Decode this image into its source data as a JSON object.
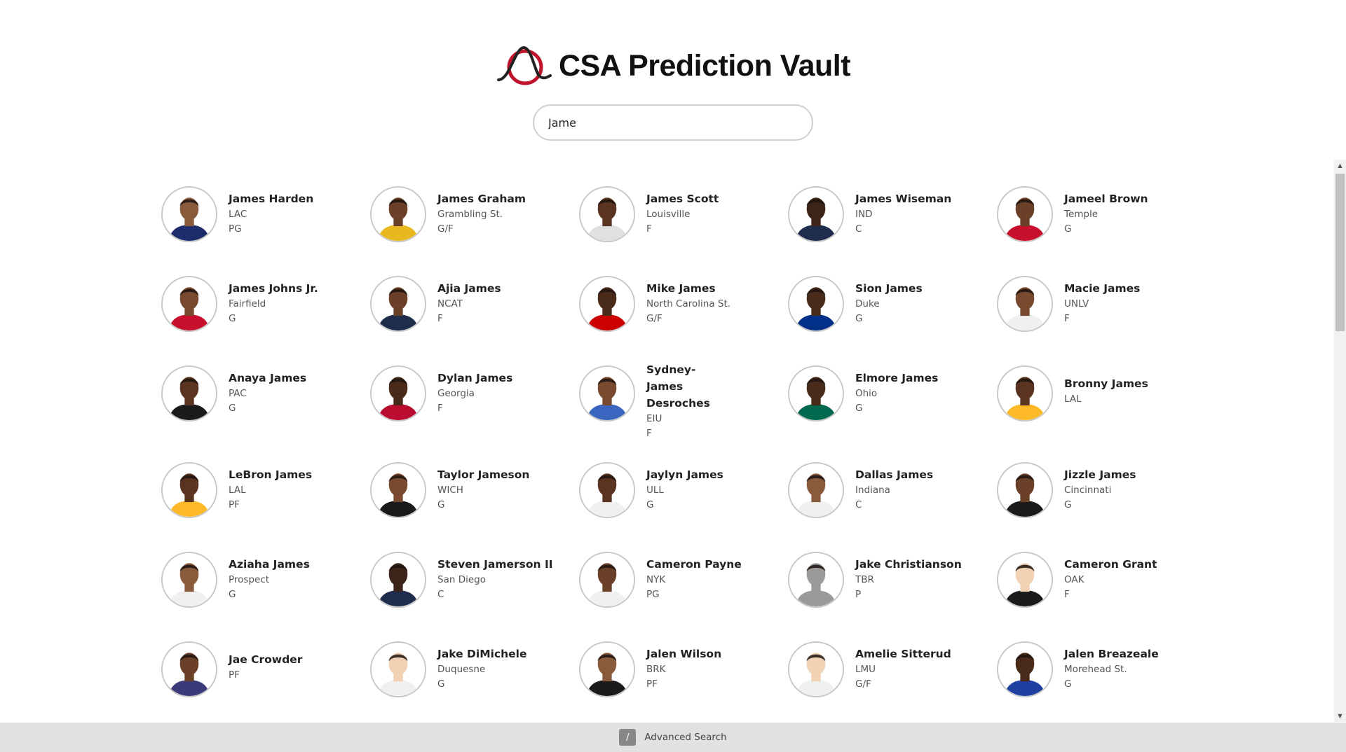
{
  "app": {
    "title": "CSA Prediction Vault",
    "logo_icon": "csa-logo-icon",
    "accent": "#c0142c"
  },
  "search": {
    "value": "Jame",
    "placeholder": ""
  },
  "players": [
    {
      "name": "James Harden",
      "team": "LAC",
      "position": "PG",
      "jersey": "#1d2d6b",
      "skin": "#8a5a3c"
    },
    {
      "name": "James Graham",
      "team": "Grambling St.",
      "position": "G/F",
      "jersey": "#e7b91f",
      "skin": "#6b4028"
    },
    {
      "name": "James Scott",
      "team": "Louisville",
      "position": "F",
      "jersey": "#e0e0e0",
      "skin": "#5a3420"
    },
    {
      "name": "James Wiseman",
      "team": "IND",
      "position": "C",
      "jersey": "#1d2d4b",
      "skin": "#3d2418"
    },
    {
      "name": "Jameel Brown",
      "team": "Temple",
      "position": "G",
      "jersey": "#c8102e",
      "skin": "#6b4028"
    },
    {
      "name": "James Johns Jr.",
      "team": "Fairfield",
      "position": "G",
      "jersey": "#c8102e",
      "skin": "#7a4a30"
    },
    {
      "name": "Ajia James",
      "team": "NCAT",
      "position": "F",
      "jersey": "#1d2d4b",
      "skin": "#6b4028"
    },
    {
      "name": "Mike James",
      "team": "North Carolina St.",
      "position": "G/F",
      "jersey": "#cc0000",
      "skin": "#4a2a18"
    },
    {
      "name": "Sion James",
      "team": "Duke",
      "position": "G",
      "jersey": "#003087",
      "skin": "#4a2a18"
    },
    {
      "name": "Macie James",
      "team": "UNLV",
      "position": "F",
      "jersey": "#f0f0f0",
      "skin": "#7a4a30"
    },
    {
      "name": "Anaya James",
      "team": "PAC",
      "position": "G",
      "jersey": "#1a1a1a",
      "skin": "#5a3420"
    },
    {
      "name": "Dylan James",
      "team": "Georgia",
      "position": "F",
      "jersey": "#ba0c2f",
      "skin": "#4a2a18"
    },
    {
      "name": "Sydney-James Desroches",
      "team": "EIU",
      "position": "F",
      "jersey": "#3a66c0",
      "skin": "#7a4a30"
    },
    {
      "name": "Elmore James",
      "team": "Ohio",
      "position": "G",
      "jersey": "#00694e",
      "skin": "#4a2a18"
    },
    {
      "name": "Bronny James",
      "team": "LAL",
      "position": "",
      "jersey": "#fdb927",
      "skin": "#5a3420"
    },
    {
      "name": "LeBron James",
      "team": "LAL",
      "position": "PF",
      "jersey": "#fdb927",
      "skin": "#5a3420"
    },
    {
      "name": "Taylor Jameson",
      "team": "WICH",
      "position": "G",
      "jersey": "#1a1a1a",
      "skin": "#7a4a30"
    },
    {
      "name": "Jaylyn James",
      "team": "ULL",
      "position": "G",
      "jersey": "#f0f0f0",
      "skin": "#5a3420"
    },
    {
      "name": "Dallas James",
      "team": "Indiana",
      "position": "C",
      "jersey": "#f0f0f0",
      "skin": "#8a5a3c"
    },
    {
      "name": "Jizzle James",
      "team": "Cincinnati",
      "position": "G",
      "jersey": "#1a1a1a",
      "skin": "#6b4028"
    },
    {
      "name": "Aziaha James",
      "team": "Prospect",
      "position": "G",
      "jersey": "#f0f0f0",
      "skin": "#8a5a3c"
    },
    {
      "name": "Steven Jamerson II",
      "team": "San Diego",
      "position": "C",
      "jersey": "#1d2d4b",
      "skin": "#3d2418"
    },
    {
      "name": "Cameron Payne",
      "team": "NYK",
      "position": "PG",
      "jersey": "#f0f0f0",
      "skin": "#6b4028"
    },
    {
      "name": "Jake Christianson",
      "team": "TBR",
      "position": "P",
      "jersey": "#9a9a9a",
      "skin": "#9a9a9a"
    },
    {
      "name": "Cameron Grant",
      "team": "OAK",
      "position": "F",
      "jersey": "#1a1a1a",
      "skin": "#f1d2b4"
    },
    {
      "name": "Jae Crowder",
      "team": "PF",
      "position": "",
      "jersey": "#3a3a7a",
      "skin": "#6b4028"
    },
    {
      "name": "Jake DiMichele",
      "team": "Duquesne",
      "position": "G",
      "jersey": "#f0f0f0",
      "skin": "#f1d2b4"
    },
    {
      "name": "Jalen Wilson",
      "team": "BRK",
      "position": "PF",
      "jersey": "#1a1a1a",
      "skin": "#8a5a3c"
    },
    {
      "name": "Amelie Sitterud",
      "team": "LMU",
      "position": "G/F",
      "jersey": "#f0f0f0",
      "skin": "#f1d2b4"
    },
    {
      "name": "Jalen Breazeale",
      "team": "Morehead St.",
      "position": "G",
      "jersey": "#1f3fa0",
      "skin": "#4a2a18"
    }
  ],
  "footer": {
    "shortcut_key": "/",
    "advanced_search_label": "Advanced Search"
  },
  "scrollbar": {
    "up_icon": "chevron-up-icon",
    "down_icon": "chevron-down-icon"
  }
}
